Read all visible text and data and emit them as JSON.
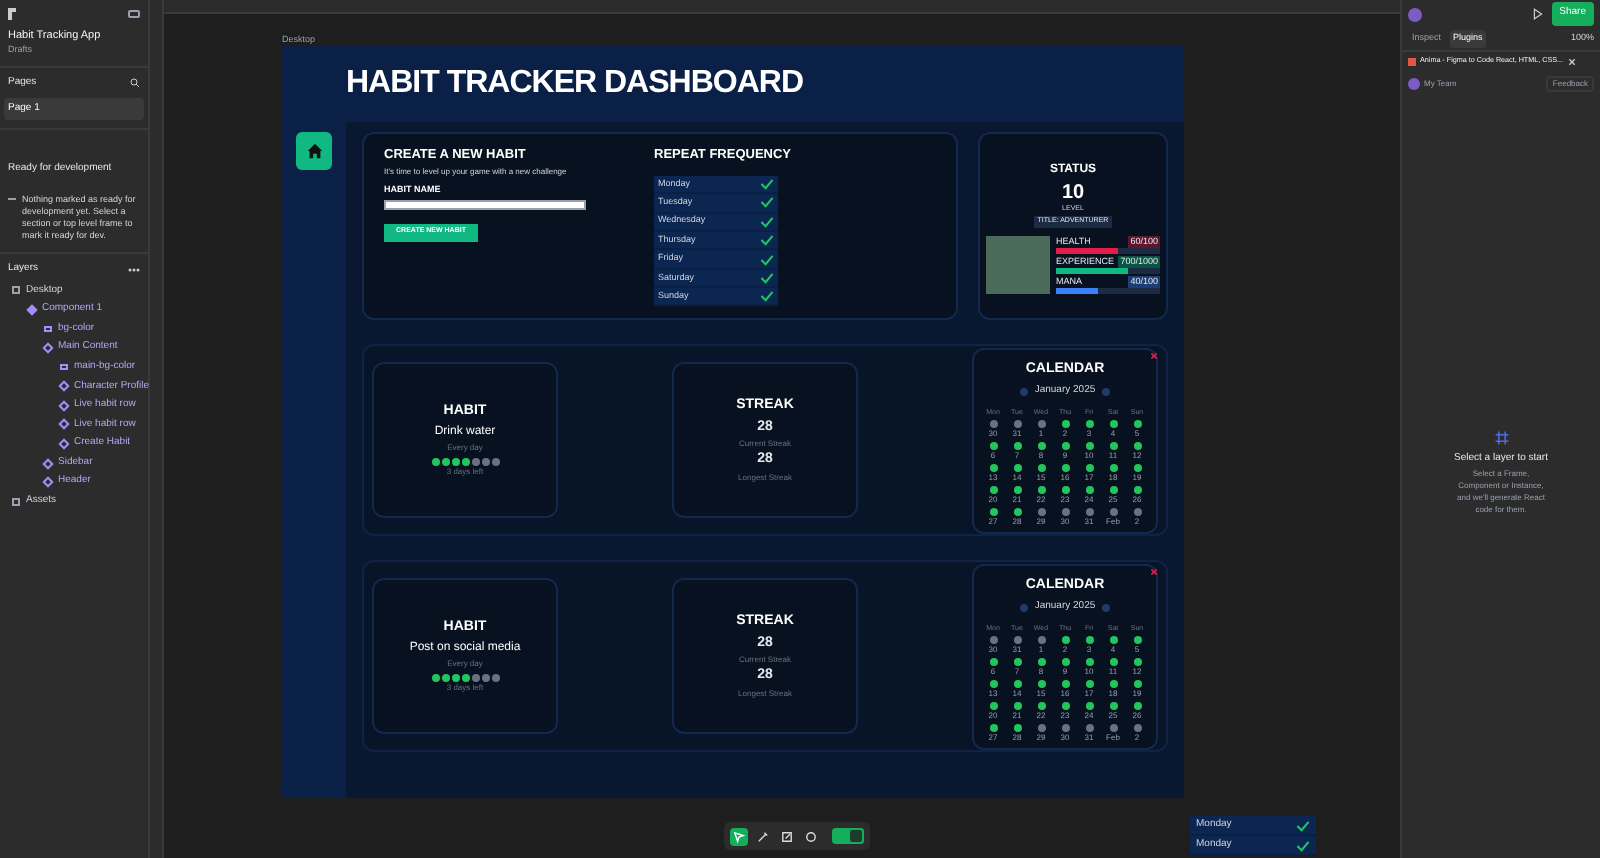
{
  "file": {
    "title": "Habit Tracking App",
    "location": "Drafts"
  },
  "pages": {
    "heading": "Pages",
    "items": [
      {
        "label": "Page 1",
        "selected": true
      }
    ]
  },
  "ready": {
    "heading": "Ready for development",
    "message": "Nothing marked as ready for development yet. Select a section or top level frame to mark it ready for dev."
  },
  "layers": {
    "heading": "Layers",
    "tree": [
      {
        "label": "Desktop",
        "kind": "frame",
        "children": [
          {
            "label": "Component 1",
            "kind": "component",
            "children": [
              {
                "label": "bg-color",
                "kind": "rect"
              },
              {
                "label": "Main Content",
                "kind": "instance",
                "children": [
                  {
                    "label": "main-bg-color",
                    "kind": "rect"
                  },
                  {
                    "label": "Character Profile",
                    "kind": "instance"
                  },
                  {
                    "label": "Live habit row",
                    "kind": "instance"
                  },
                  {
                    "label": "Live habit row",
                    "kind": "instance"
                  },
                  {
                    "label": "Create Habit",
                    "kind": "instance"
                  }
                ]
              },
              {
                "label": "Sidebar",
                "kind": "instance"
              },
              {
                "label": "Header",
                "kind": "instance"
              }
            ]
          }
        ]
      }
    ]
  },
  "assets": "Assets",
  "frame_label": "Desktop",
  "dashboard": {
    "title": "HABIT TRACKER DASHBOARD",
    "create": {
      "heading": "CREATE A NEW HABIT",
      "subtitle": "It's time to level up your game with a new challenge",
      "field_label": "HABIT NAME",
      "button": "CREATE NEW HABIT"
    },
    "frequency": {
      "heading": "REPEAT FREQUENCY",
      "days": [
        {
          "label": "Monday",
          "checked": true
        },
        {
          "label": "Tuesday",
          "checked": true
        },
        {
          "label": "Wednesday",
          "checked": true
        },
        {
          "label": "Thursday",
          "checked": true
        },
        {
          "label": "Friday",
          "checked": true
        },
        {
          "label": "Saturday",
          "checked": true
        },
        {
          "label": "Sunday",
          "checked": true
        }
      ]
    },
    "status": {
      "heading": "STATUS",
      "level": "10",
      "level_label": "LEVEL",
      "title": "TITLE: ADVENTURER",
      "stats": [
        {
          "label": "HEALTH",
          "reading": "60/100",
          "level": 0.6,
          "color": "#e11d48"
        },
        {
          "label": "EXPERIENCE",
          "reading": "700/1000",
          "level": 0.7,
          "color": "#10b981"
        },
        {
          "label": "MANA",
          "reading": "40/100",
          "level": 0.4,
          "color": "#3b82f6"
        }
      ]
    },
    "habits": [
      {
        "heading": "HABIT",
        "name": "Drink water",
        "frequency": "Every day",
        "week": [
          {
            "done": true
          },
          {
            "done": true
          },
          {
            "done": true
          },
          {
            "done": true
          },
          {
            "done": false
          },
          {
            "done": false
          },
          {
            "done": false
          }
        ],
        "remaining": "3 days left",
        "streak": {
          "heading": "STREAK",
          "current": "28",
          "current_label": "Current Streak",
          "longest": "28",
          "longest_label": "Longest Streak"
        },
        "calendar": {
          "heading": "CALENDAR",
          "month": "January 2025",
          "weekdays": [
            "Mon",
            "Tue",
            "Wed",
            "Thu",
            "Fri",
            "Sat",
            "Sun"
          ],
          "days": [
            {
              "label": "30",
              "done": false
            },
            {
              "label": "31",
              "done": false
            },
            {
              "label": "1",
              "done": false
            },
            {
              "label": "2",
              "done": true
            },
            {
              "label": "3",
              "done": true
            },
            {
              "label": "4",
              "done": true
            },
            {
              "label": "5",
              "done": true
            },
            {
              "label": "6",
              "done": true
            },
            {
              "label": "7",
              "done": true
            },
            {
              "label": "8",
              "done": true
            },
            {
              "label": "9",
              "done": true
            },
            {
              "label": "10",
              "done": true
            },
            {
              "label": "11",
              "done": true
            },
            {
              "label": "12",
              "done": true
            },
            {
              "label": "13",
              "done": true
            },
            {
              "label": "14",
              "done": true
            },
            {
              "label": "15",
              "done": true
            },
            {
              "label": "16",
              "done": true
            },
            {
              "label": "17",
              "done": true
            },
            {
              "label": "18",
              "done": true
            },
            {
              "label": "19",
              "done": true
            },
            {
              "label": "20",
              "done": true
            },
            {
              "label": "21",
              "done": true
            },
            {
              "label": "22",
              "done": true
            },
            {
              "label": "23",
              "done": true
            },
            {
              "label": "24",
              "done": true
            },
            {
              "label": "25",
              "done": true
            },
            {
              "label": "26",
              "done": true
            },
            {
              "label": "27",
              "done": true
            },
            {
              "label": "28",
              "done": true
            },
            {
              "label": "29",
              "done": false
            },
            {
              "label": "30",
              "done": false
            },
            {
              "label": "31",
              "done": false
            },
            {
              "label": "Feb",
              "done": false
            },
            {
              "label": "2",
              "done": false
            }
          ]
        }
      },
      {
        "heading": "HABIT",
        "name": "Post on social media",
        "frequency": "Every day",
        "week": [
          {
            "done": true
          },
          {
            "done": true
          },
          {
            "done": true
          },
          {
            "done": true
          },
          {
            "done": false
          },
          {
            "done": false
          },
          {
            "done": false
          }
        ],
        "remaining": "3 days left",
        "streak": {
          "heading": "STREAK",
          "current": "28",
          "current_label": "Current Streak",
          "longest": "28",
          "longest_label": "Longest Streak"
        },
        "calendar": {
          "heading": "CALENDAR",
          "month": "January 2025",
          "weekdays": [
            "Mon",
            "Tue",
            "Wed",
            "Thu",
            "Fri",
            "Sat",
            "Sun"
          ],
          "days": [
            {
              "label": "30",
              "done": false
            },
            {
              "label": "31",
              "done": false
            },
            {
              "label": "1",
              "done": false
            },
            {
              "label": "2",
              "done": true
            },
            {
              "label": "3",
              "done": true
            },
            {
              "label": "4",
              "done": true
            },
            {
              "label": "5",
              "done": true
            },
            {
              "label": "6",
              "done": true
            },
            {
              "label": "7",
              "done": true
            },
            {
              "label": "8",
              "done": true
            },
            {
              "label": "9",
              "done": true
            },
            {
              "label": "10",
              "done": true
            },
            {
              "label": "11",
              "done": true
            },
            {
              "label": "12",
              "done": true
            },
            {
              "label": "13",
              "done": true
            },
            {
              "label": "14",
              "done": true
            },
            {
              "label": "15",
              "done": true
            },
            {
              "label": "16",
              "done": true
            },
            {
              "label": "17",
              "done": true
            },
            {
              "label": "18",
              "done": true
            },
            {
              "label": "19",
              "done": true
            },
            {
              "label": "20",
              "done": true
            },
            {
              "label": "21",
              "done": true
            },
            {
              "label": "22",
              "done": true
            },
            {
              "label": "23",
              "done": true
            },
            {
              "label": "24",
              "done": true
            },
            {
              "label": "25",
              "done": true
            },
            {
              "label": "26",
              "done": true
            },
            {
              "label": "27",
              "done": true
            },
            {
              "label": "28",
              "done": true
            },
            {
              "label": "29",
              "done": false
            },
            {
              "label": "30",
              "done": false
            },
            {
              "label": "31",
              "done": false
            },
            {
              "label": "Feb",
              "done": false
            },
            {
              "label": "2",
              "done": false
            }
          ]
        }
      }
    ]
  },
  "floating_list": [
    {
      "label": "Monday",
      "checked": true
    },
    {
      "label": "Monday",
      "checked": true
    }
  ],
  "toolbar": [
    {
      "kind": "move",
      "selected": true
    },
    {
      "kind": "pen",
      "selected": false
    },
    {
      "kind": "edit",
      "selected": false
    },
    {
      "kind": "comment",
      "selected": false
    }
  ],
  "dev_mode": {
    "on": true
  },
  "right": {
    "share": "Share",
    "tabs": [
      {
        "label": "Inspect",
        "selected": false
      },
      {
        "label": "Plugins",
        "selected": true
      }
    ],
    "zoom": "100%",
    "plugin": "Anima - Figma to Code React, HTML, CSS...",
    "team": "My Team",
    "feedback": "Feedback",
    "empty_title": "Select a layer to start",
    "empty_text": "Select a Frame, Component or Instance, and we'll generate React code for them."
  }
}
